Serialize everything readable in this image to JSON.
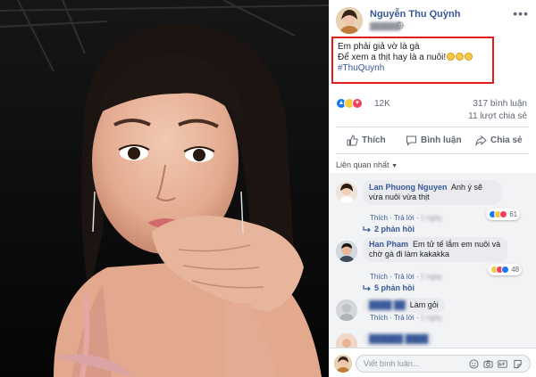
{
  "post": {
    "author": "Nguyễn Thu Quỳnh",
    "line1": "Em phải giả vờ là gà",
    "line2": "Để xem a thịt hay là a nuôi!",
    "hashtag": "#ThuQuynh"
  },
  "stats": {
    "reaction_count": "12K",
    "comments": "317 bình luận",
    "shares": "11 lượt chia sẻ"
  },
  "actions": {
    "like": "Thích",
    "comment": "Bình luận",
    "share": "Chia sẻ"
  },
  "sort_label": "Liên quan nhất",
  "comments": [
    {
      "name": "Lan Phuong Nguyen",
      "text": "Anh ý sẽ vừa nuôi vừa thịt",
      "like": "Thích",
      "reply": "Trả lời",
      "reactions": "61",
      "replies": "2 phản hồi"
    },
    {
      "name": "Han Pham",
      "text": "Em tử tế lắm em nuôi và chờ gà đi làm kakakka",
      "like": "Thích",
      "reply": "Trả lời",
      "reactions": "48",
      "replies": "5 phản hồi"
    },
    {
      "text": "Làm gỏi",
      "like": "Thích",
      "reply": "Trả lời"
    }
  ],
  "compose": {
    "placeholder": "Viết bình luận..."
  },
  "icons": [
    "globe-icon",
    "more-options-icon",
    "like-icon",
    "comment-icon",
    "share-icon",
    "reply-arrow-icon",
    "emoji-icon",
    "camera-icon",
    "gif-icon",
    "sticker-icon"
  ],
  "colors": {
    "link_blue": "#385898",
    "highlight_red": "#e21b1b",
    "like_blue": "#1877f2",
    "love_red": "#f33e58",
    "haha_yellow": "#f7c843"
  }
}
